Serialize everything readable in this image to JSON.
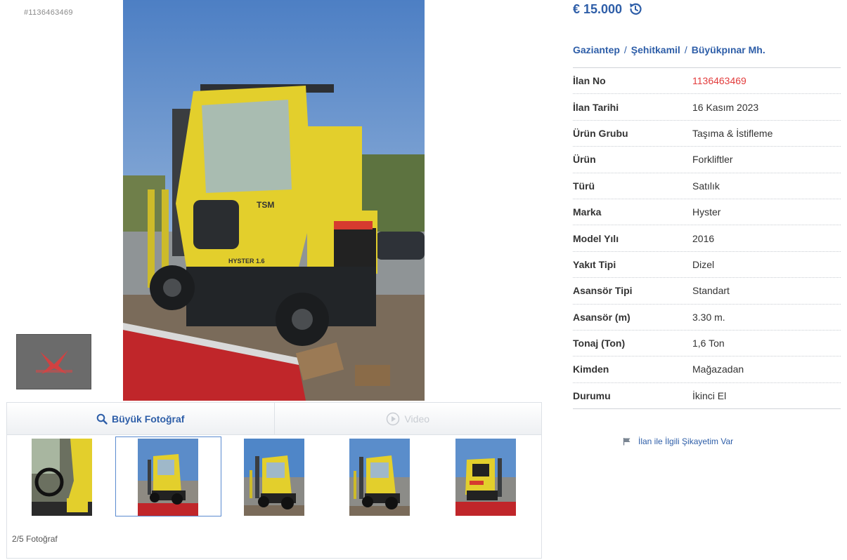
{
  "listing_id_caption": "#1136463469",
  "main_photo": {
    "cab_brand": "TSM",
    "model_badge": "HYSTER 1.6"
  },
  "toolbar": {
    "big_photo_label": "Büyük Fotoğraf",
    "video_label": "Video"
  },
  "gallery": {
    "count_label": "2/5 Fotoğraf",
    "selected_index": 2,
    "total": 5
  },
  "price": "€ 15.000",
  "location": {
    "city": "Gaziantep",
    "district": "Şehitkamil",
    "neighborhood": "Büyükpınar Mh.",
    "separator": "/"
  },
  "details": [
    {
      "label": "İlan No",
      "value": "1136463469"
    },
    {
      "label": "İlan Tarihi",
      "value": "16 Kasım 2023"
    },
    {
      "label": "Ürün Grubu",
      "value": "Taşıma & İstifleme"
    },
    {
      "label": "Ürün",
      "value": "Forkliftler"
    },
    {
      "label": "Türü",
      "value": "Satılık"
    },
    {
      "label": "Marka",
      "value": "Hyster"
    },
    {
      "label": "Model Yılı",
      "value": "2016"
    },
    {
      "label": "Yakıt Tipi",
      "value": "Dizel"
    },
    {
      "label": "Asansör Tipi",
      "value": "Standart"
    },
    {
      "label": "Asansör (m)",
      "value": "3.30 m."
    },
    {
      "label": "Tonaj (Ton)",
      "value": "1,6 Ton"
    },
    {
      "label": "Kimden",
      "value": "Mağazadan"
    },
    {
      "label": "Durumu",
      "value": "İkinci El"
    }
  ],
  "complaint_label": "İlan ile İlgili Şikayetim Var",
  "colors": {
    "accent": "#2e5ea8",
    "id_red": "#e23c3c",
    "forklift_yellow": "#e3cf2c"
  }
}
